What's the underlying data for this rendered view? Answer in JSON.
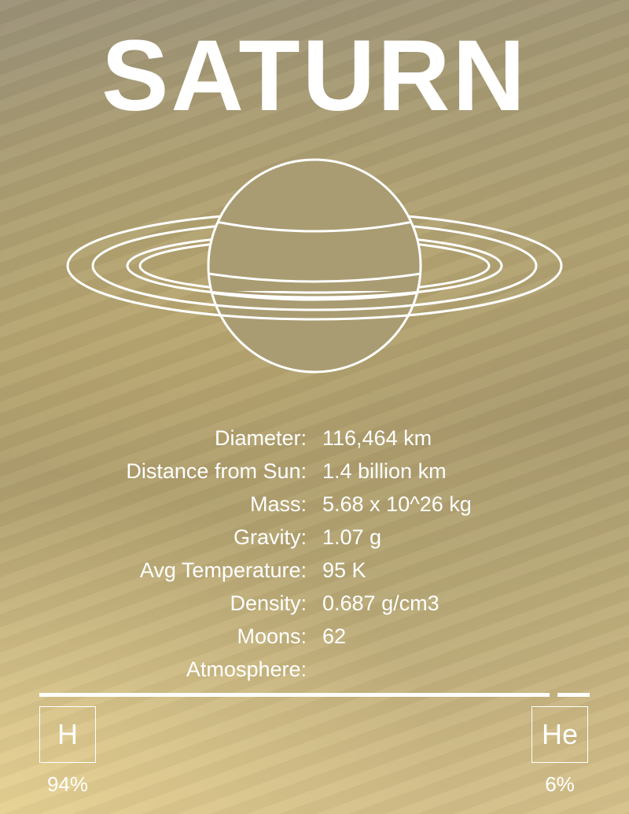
{
  "title": "SATURN",
  "stats": [
    {
      "label": "Diameter:",
      "value": "116,464 km"
    },
    {
      "label": "Distance from Sun:",
      "value": "1.4 billion km"
    },
    {
      "label": "Mass:",
      "value": "5.68 x 10^26 kg"
    },
    {
      "label": "Gravity:",
      "value": "1.07 g"
    },
    {
      "label": "Avg Temperature:",
      "value": "95 K"
    },
    {
      "label": "Density:",
      "value": "0.687 g/cm3"
    },
    {
      "label": "Moons:",
      "value": "62"
    },
    {
      "label": "Atmosphere:",
      "value": ""
    }
  ],
  "atmosphere": {
    "elements": [
      {
        "symbol": "H",
        "percent": "94%",
        "fraction": 0.94
      },
      {
        "symbol": "He",
        "percent": "6%",
        "fraction": 0.06
      }
    ]
  },
  "colors": {
    "line": "#ffffff"
  },
  "icons": {
    "illustration": "saturn-outline-icon"
  }
}
